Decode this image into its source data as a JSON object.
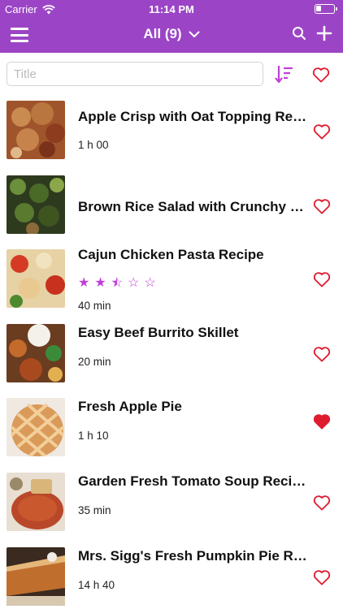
{
  "status_bar": {
    "carrier": "Carrier",
    "time": "11:14 PM"
  },
  "nav": {
    "title": "All (9)"
  },
  "search": {
    "placeholder": "Title"
  },
  "colors": {
    "accent": "#9b45c6",
    "heart": "#e01b2f",
    "star": "#c03ed9"
  },
  "recipes": [
    {
      "name": "Apple Crisp with Oat Topping Recipe",
      "duration": "1 h 00",
      "favorite": false,
      "thumb": "apple-crisp"
    },
    {
      "name": "Brown Rice Salad with Crunchy Vegetables",
      "duration": "",
      "favorite": false,
      "thumb": "rice-salad"
    },
    {
      "name": "Cajun Chicken Pasta Recipe",
      "duration": "40 min",
      "favorite": false,
      "rating": 2.5,
      "thumb": "pasta"
    },
    {
      "name": "Easy Beef Burrito Skillet",
      "duration": "20 min",
      "favorite": false,
      "thumb": "burrito"
    },
    {
      "name": "Fresh Apple Pie",
      "duration": "1 h 10",
      "favorite": true,
      "thumb": "apple-pie"
    },
    {
      "name": "Garden Fresh Tomato Soup Recipe",
      "duration": "35 min",
      "favorite": false,
      "thumb": "tomato-soup"
    },
    {
      "name": "Mrs. Sigg's Fresh Pumpkin Pie Recipe",
      "duration": "14 h 40",
      "favorite": false,
      "thumb": "pumpkin-pie"
    }
  ]
}
